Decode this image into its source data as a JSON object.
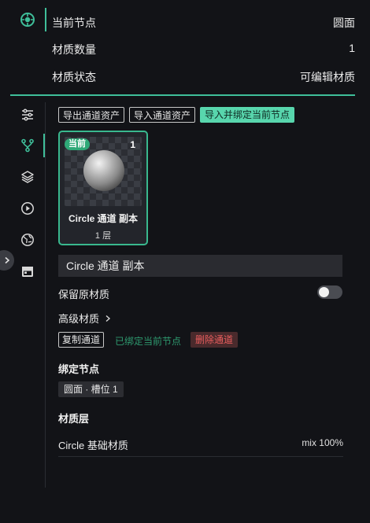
{
  "info": {
    "current_node_label": "当前节点",
    "current_node_value": "圆面",
    "material_count_label": "材质数量",
    "material_count_value": "1",
    "material_status_label": "材质状态",
    "material_status_value": "可编辑材质"
  },
  "sidebar": {
    "icons": [
      "sliders-icon",
      "branch-icon",
      "layers-icon",
      "play-icon",
      "globe-icon",
      "calendar-icon"
    ],
    "active": "branch-icon"
  },
  "toolbar": {
    "export_label": "导出通道资产",
    "import_label": "导入通道资产",
    "import_bind_label": "导入并绑定当前节点"
  },
  "card": {
    "badge": "当前",
    "count": "1",
    "title": "Circle 通道 副本",
    "subtitle": "1 层"
  },
  "channel_name": "Circle 通道 副本",
  "keep_original_label": "保留原材质",
  "keep_original_on": false,
  "advanced_label": "高级材质",
  "actions": {
    "copy_label": "复制通道",
    "bound_label": "已绑定当前节点",
    "delete_label": "删除通道"
  },
  "bind_section": {
    "title": "绑定节点",
    "chip": "圆面 · 槽位 1"
  },
  "layers_section": {
    "title": "材质层",
    "items": [
      {
        "name": "Circle 基础材质",
        "mix": "mix 100%"
      }
    ]
  },
  "colors": {
    "accent": "#3fbf9a",
    "primary_button": "#58d6ad",
    "danger": "#e85d5d",
    "bound_text": "#2e9a6f",
    "background": "#121317"
  }
}
